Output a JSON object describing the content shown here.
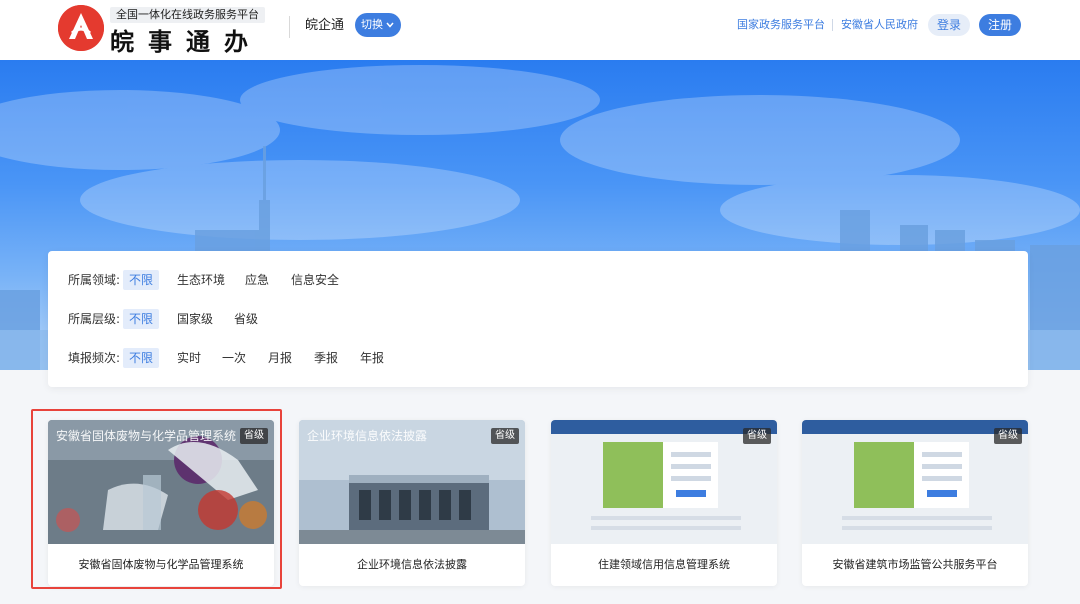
{
  "header": {
    "logo_subtitle": "全国一体化在线政务服务平台",
    "logo_title": "皖事通办",
    "app_name": "皖企通",
    "switch_label": "切换",
    "links": [
      "国家政务服务平台",
      "安徽省人民政府"
    ],
    "login_label": "登录",
    "register_label": "注册",
    "icons": [
      "logo-mark-icon",
      "chevron-down-icon"
    ]
  },
  "filters": {
    "domain": {
      "label": "所属领域:",
      "options": [
        "不限",
        "生态环境",
        "应急",
        "信息安全"
      ],
      "selected": "不限"
    },
    "level": {
      "label": "所属层级:",
      "options": [
        "不限",
        "国家级",
        "省级"
      ],
      "selected": "不限"
    },
    "frequency": {
      "label": "填报频次:",
      "options": [
        "不限",
        "实时",
        "一次",
        "月报",
        "季报",
        "年报"
      ],
      "selected": "不限"
    }
  },
  "cards": [
    {
      "overlay_title": "安徽省固体废物与化学品管理系统",
      "badge": "省级",
      "name": "安徽省固体废物与化学品管理系统",
      "highlighted": true
    },
    {
      "overlay_title": "企业环境信息依法披露",
      "badge": "省级",
      "name": "企业环境信息依法披露",
      "highlighted": false
    },
    {
      "overlay_title": "",
      "badge": "省级",
      "name": "住建领域信用信息管理系统",
      "highlighted": false
    },
    {
      "overlay_title": "",
      "badge": "省级",
      "name": "安徽省建筑市场监管公共服务平台",
      "highlighted": false
    }
  ],
  "colors": {
    "accent": "#3d7de0",
    "logo_red": "#e43a2f",
    "highlight_red": "#e8433b",
    "active_filter_bg": "#e3ecfb"
  }
}
